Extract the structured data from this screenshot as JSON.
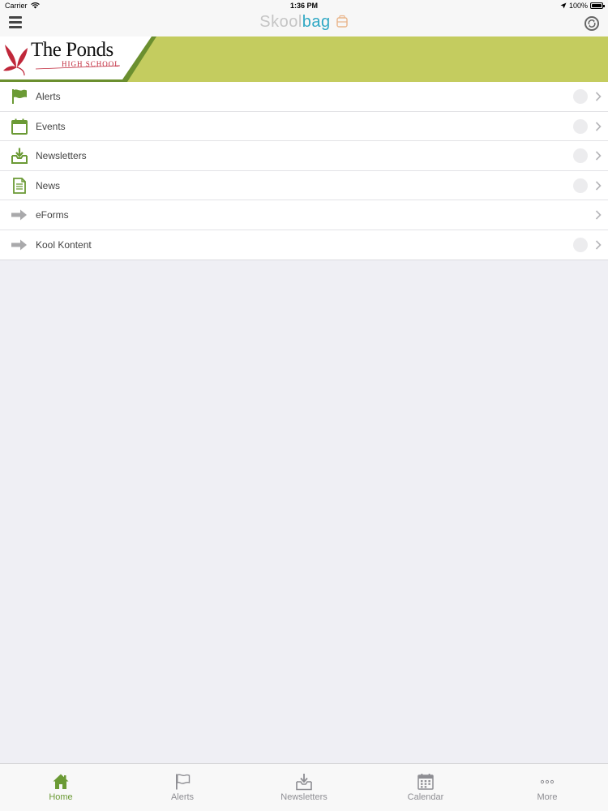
{
  "status_bar": {
    "carrier": "Carrier",
    "time": "1:36 PM",
    "battery": "100%",
    "battery_level": 1.0
  },
  "nav": {
    "title_part1": "Skool",
    "title_part2": "bag"
  },
  "banner": {
    "school_name": "The Ponds",
    "school_subtitle": "HIGH SCHOOL"
  },
  "menu": {
    "items": [
      {
        "label": "Alerts",
        "icon": "flag-icon"
      },
      {
        "label": "Events",
        "icon": "calendar-icon"
      },
      {
        "label": "Newsletters",
        "icon": "inbox-download-icon"
      },
      {
        "label": "News",
        "icon": "document-icon"
      },
      {
        "label": "eForms",
        "icon": "arrow-right-icon"
      },
      {
        "label": "Kool Kontent",
        "icon": "arrow-right-icon"
      }
    ]
  },
  "tabs": [
    {
      "label": "Home",
      "icon": "home-icon",
      "active": true
    },
    {
      "label": "Alerts",
      "icon": "flag-icon"
    },
    {
      "label": "Newsletters",
      "icon": "inbox-download-icon"
    },
    {
      "label": "Calendar",
      "icon": "calendar-icon"
    },
    {
      "label": "More",
      "icon": "more-dots-icon"
    }
  ],
  "colors": {
    "accent_green": "#6b9a35",
    "banner_green": "#c4cc5f",
    "brand_blue": "#2fa8c4",
    "school_red": "#c0273a"
  }
}
